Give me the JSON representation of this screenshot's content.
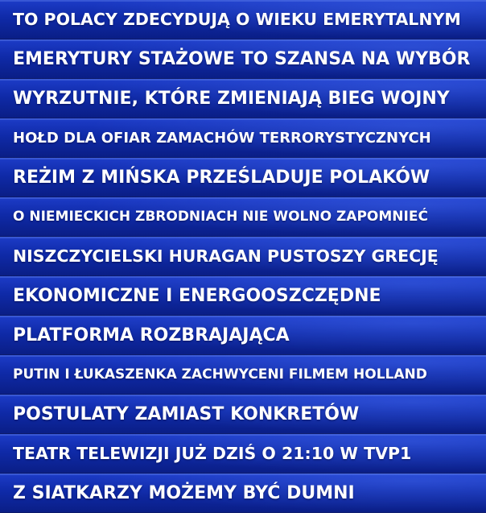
{
  "headlines": [
    "TO POLACY ZDECYDUJĄ O WIEKU EMERYTALNYM",
    "EMERYTURY STAŻOWE TO SZANSA NA WYBÓR",
    "WYRZUTNIE, KTÓRE ZMIENIAJĄ BIEG WOJNY",
    "HOŁD DLA OFIAR ZAMACHÓW TERRORYSTYCZNYCH",
    "REŻIM Z MIŃSKA PRZEŚLADUJE POLAKÓW",
    "O NIEMIECKICH ZBRODNIACH NIE WOLNO ZAPOMNIEĆ",
    "NISZCZYCIELSKI HURAGAN PUSTOSZY GRECJĘ",
    "EKONOMICZNE I ENERGOOSZCZĘDNE",
    "PLATFORMA ROZBRAJAJĄCA",
    "PUTIN I ŁUKASZENKA ZACHWYCENI FILMEM HOLLAND",
    "POSTULATY ZAMIAST KONKRETÓW",
    "TEATR TELEWIZJI JUŻ DZIŚ O 21:10 W TVP1",
    "Z SIATKARZY MOŻEMY BYĆ DUMNI"
  ],
  "colors": {
    "strip_background": "#0f2aa8",
    "text": "#ffffff"
  }
}
